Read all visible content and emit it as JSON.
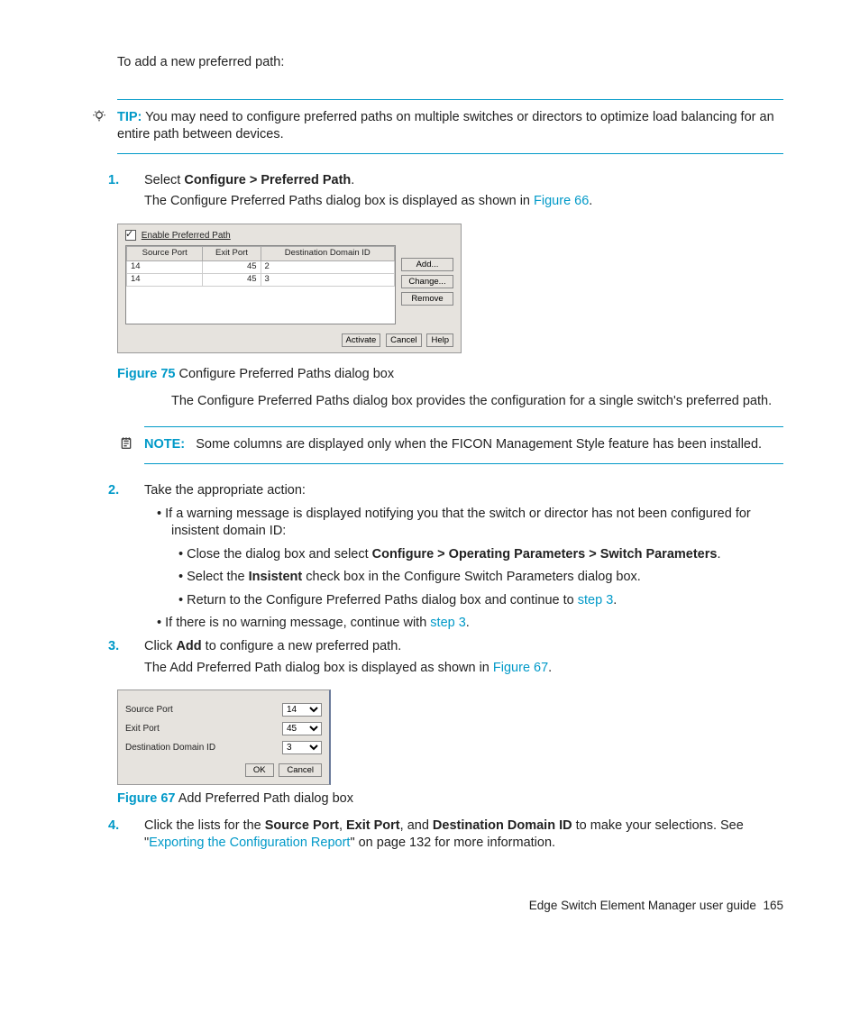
{
  "intro": "To add a new preferred path:",
  "tip": {
    "label": "TIP:",
    "text": "You may need to configure preferred paths on multiple switches or directors to optimize load balancing for an entire path between devices."
  },
  "step1": {
    "num": "1.",
    "text_a": "Select ",
    "bold_a": "Configure > Preferred Path",
    "text_b": ".",
    "line2_a": "The Configure Preferred Paths dialog box is displayed as shown in ",
    "link": "Figure 66",
    "line2_b": "."
  },
  "dialog1": {
    "enable": "Enable Preferred Path",
    "headers": [
      "Source Port",
      "Exit Port",
      "Destination Domain ID"
    ],
    "rows": [
      {
        "sp": "14",
        "ep": "45",
        "dd": "2"
      },
      {
        "sp": "14",
        "ep": "45",
        "dd": "3"
      }
    ],
    "side": {
      "add": "Add...",
      "change": "Change...",
      "remove": "Remove"
    },
    "bottom": {
      "activate": "Activate",
      "cancel": "Cancel",
      "help": "Help"
    }
  },
  "fig75": {
    "label": "Figure 75",
    "caption": " Configure Preferred Paths dialog box"
  },
  "afterFig75": "The Configure Preferred Paths dialog box provides the configuration for a single switch's preferred path.",
  "note": {
    "label": "NOTE:",
    "text": "Some columns are displayed only when the FICON Management Style feature has been installed."
  },
  "step2": {
    "num": "2.",
    "text": "Take the appropriate action:",
    "b1": "If a warning message is displayed notifying you that the switch or director has not been configured for insistent domain ID:",
    "b2a_a": "Close the dialog box and select ",
    "b2a_bold": "Configure > Operating Parameters > Switch Parameters",
    "b2a_b": ".",
    "b2b_a": "Select the ",
    "b2b_bold": "Insistent",
    "b2b_b": " check box in the Configure Switch Parameters dialog box.",
    "b2c_a": "Return to the Configure Preferred Paths dialog box and continue to ",
    "b2c_link": "step 3",
    "b2c_b": ".",
    "b3_a": "If there is no warning message, continue with ",
    "b3_link": "step 3",
    "b3_b": "."
  },
  "step3": {
    "num": "3.",
    "a": "Click ",
    "bold": "Add",
    "b": " to configure a new preferred path.",
    "line2_a": "The Add Preferred Path dialog box is displayed as shown in ",
    "link": "Figure 67",
    "line2_b": "."
  },
  "dialog2": {
    "rows": [
      {
        "label": "Source Port",
        "val": "14"
      },
      {
        "label": "Exit Port",
        "val": "45"
      },
      {
        "label": "Destination Domain ID",
        "val": "3"
      }
    ],
    "ok": "OK",
    "cancel": "Cancel"
  },
  "fig67": {
    "label": "Figure 67",
    "caption": " Add Preferred Path dialog box"
  },
  "step4": {
    "num": "4.",
    "a": "Click the lists for the ",
    "b1": "Source Port",
    "c": ", ",
    "b2": "Exit Port",
    "d": ", and ",
    "b3": "Destination Domain ID",
    "e": " to make your selections. See \"",
    "link": "Exporting the Configuration Report",
    "f": "\" on page 132 for more information."
  },
  "footer": {
    "title": "Edge Switch Element Manager user guide",
    "page": "165"
  }
}
